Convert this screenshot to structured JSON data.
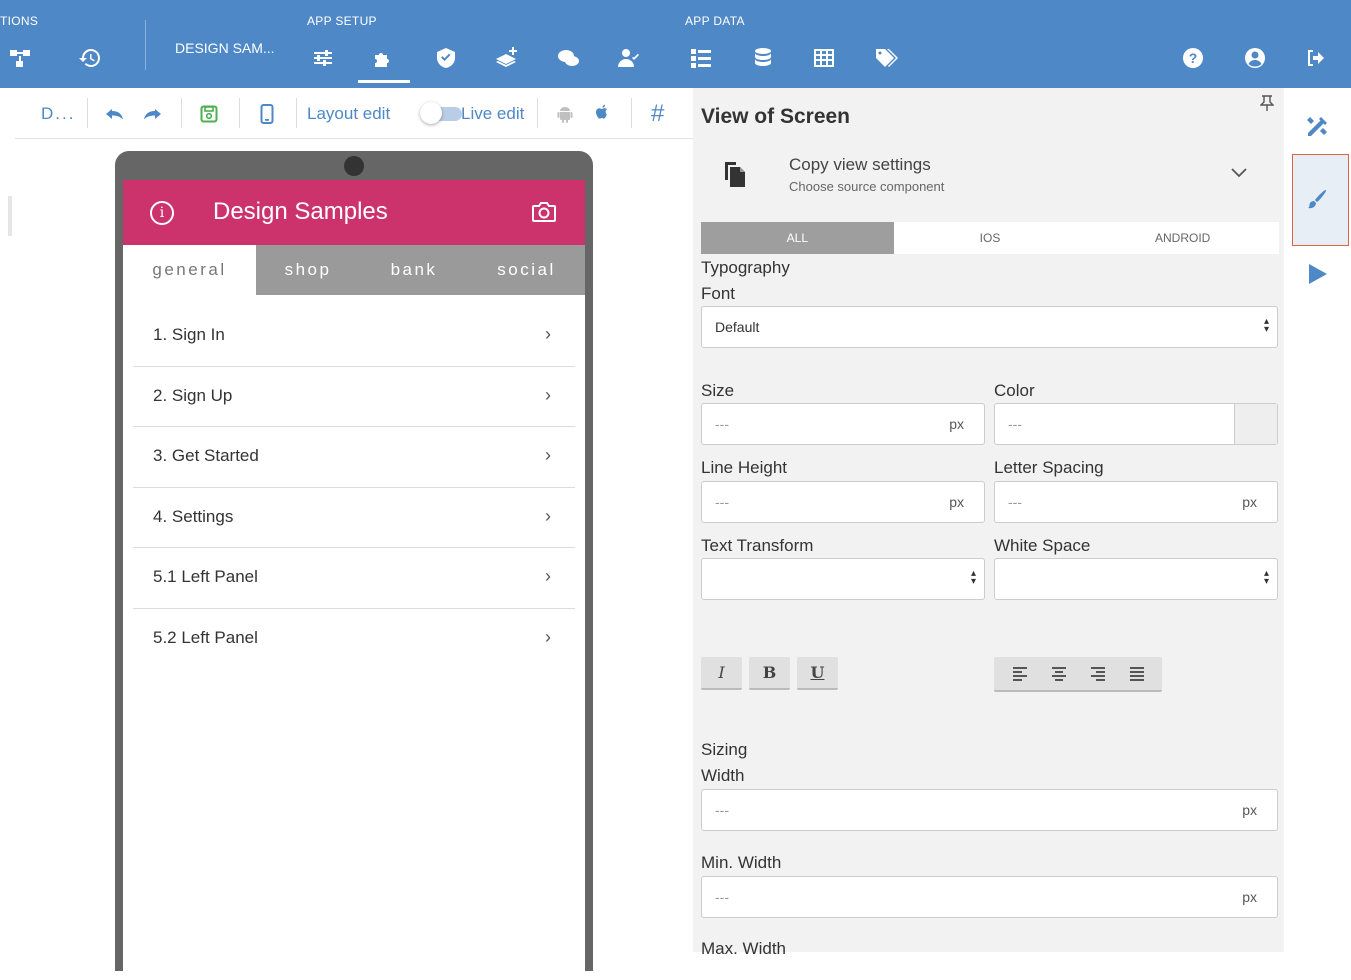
{
  "topbar": {
    "section_left": "TIONS",
    "section_setup": "APP SETUP",
    "section_data": "APP DATA",
    "app_name": "DESIGN SAM..."
  },
  "toolbar": {
    "screen_label": "D...",
    "layout_edit": "Layout edit",
    "live_edit": "Live edit",
    "hash": "#"
  },
  "phone": {
    "title": "Design Samples",
    "tabs": [
      "general",
      "shop",
      "bank",
      "social"
    ],
    "items": [
      "1. Sign In",
      "2. Sign Up",
      "3. Get Started",
      "4. Settings",
      "5.1 Left Panel",
      "5.2 Left Panel"
    ],
    "chevron": "›"
  },
  "panel": {
    "title": "View of Screen",
    "copy_title": "Copy view settings",
    "copy_sub": "Choose source component",
    "tabs": [
      "ALL",
      "IOS",
      "ANDROID"
    ],
    "typography": "Typography",
    "font_label": "Font",
    "font_value": "Default",
    "size_label": "Size",
    "color_label": "Color",
    "line_height_label": "Line Height",
    "letter_spacing_label": "Letter Spacing",
    "text_transform_label": "Text Transform",
    "white_space_label": "White Space",
    "placeholder": "---",
    "unit": "px",
    "fmt_italic": "I",
    "fmt_bold": "B",
    "fmt_underline": "U",
    "sizing": "Sizing",
    "width_label": "Width",
    "min_width_label": "Min. Width",
    "max_width_label": "Max. Width"
  }
}
